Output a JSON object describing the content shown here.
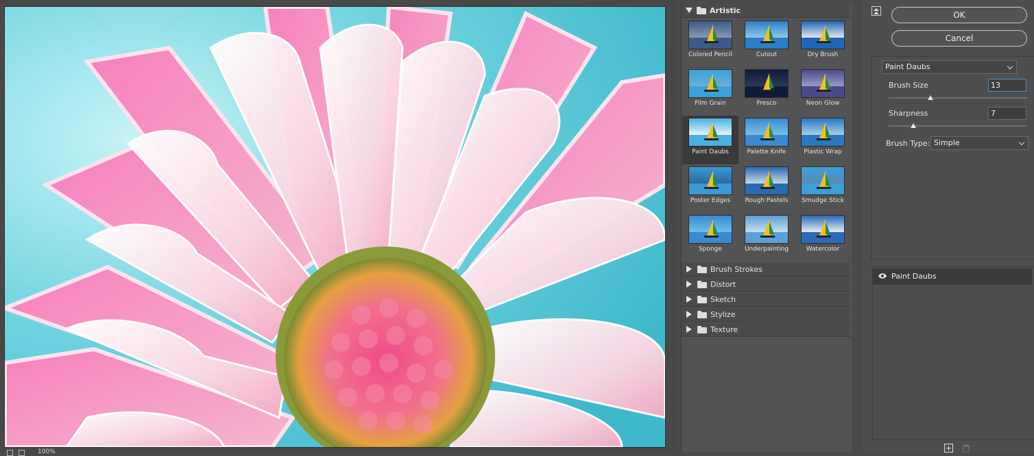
{
  "preview": {
    "zoom": "100%",
    "image": "pink-daisy-paint-daubs-preview"
  },
  "gallery": {
    "open_category": {
      "label": "Artistic",
      "filters": [
        {
          "label": "Colored Pencil",
          "icon": "colored-pencil-thumbnail"
        },
        {
          "label": "Cutout",
          "icon": "cutout-thumbnail"
        },
        {
          "label": "Dry Brush",
          "icon": "dry-brush-thumbnail"
        },
        {
          "label": "Film Grain",
          "icon": "film-grain-thumbnail"
        },
        {
          "label": "Fresco",
          "icon": "fresco-thumbnail"
        },
        {
          "label": "Neon Glow",
          "icon": "neon-glow-thumbnail"
        },
        {
          "label": "Paint Daubs",
          "icon": "paint-daubs-thumbnail"
        },
        {
          "label": "Palette Knife",
          "icon": "palette-knife-thumbnail"
        },
        {
          "label": "Plastic Wrap",
          "icon": "plastic-wrap-thumbnail"
        },
        {
          "label": "Poster Edges",
          "icon": "poster-edges-thumbnail"
        },
        {
          "label": "Rough Pastels",
          "icon": "rough-pastels-thumbnail"
        },
        {
          "label": "Smudge Stick",
          "icon": "smudge-stick-thumbnail"
        },
        {
          "label": "Sponge",
          "icon": "sponge-thumbnail"
        },
        {
          "label": "Underpainting",
          "icon": "underpainting-thumbnail"
        },
        {
          "label": "Watercolor",
          "icon": "watercolor-thumbnail"
        }
      ],
      "selected": "Paint Daubs"
    },
    "closed_categories": [
      {
        "label": "Brush Strokes"
      },
      {
        "label": "Distort"
      },
      {
        "label": "Sketch"
      },
      {
        "label": "Stylize"
      },
      {
        "label": "Texture"
      }
    ]
  },
  "dialog": {
    "ok_label": "OK",
    "cancel_label": "Cancel"
  },
  "settings": {
    "filter_select": "Paint Daubs",
    "brush_size_label": "Brush Size",
    "brush_size_value": "13",
    "brush_size_level": 0.3,
    "sharpness_label": "Sharpness",
    "sharpness_value": "7",
    "sharpness_level": 0.18,
    "brush_type_label": "Brush Type:",
    "brush_type_value": "Simple"
  },
  "layers": {
    "items": [
      {
        "label": "Paint Daubs",
        "visible": true
      }
    ]
  },
  "colors": {
    "background": "#4a4a4a",
    "panel": "#535353",
    "selected_row": "#3a3a3a",
    "focus_border": "#4a8fd9"
  }
}
